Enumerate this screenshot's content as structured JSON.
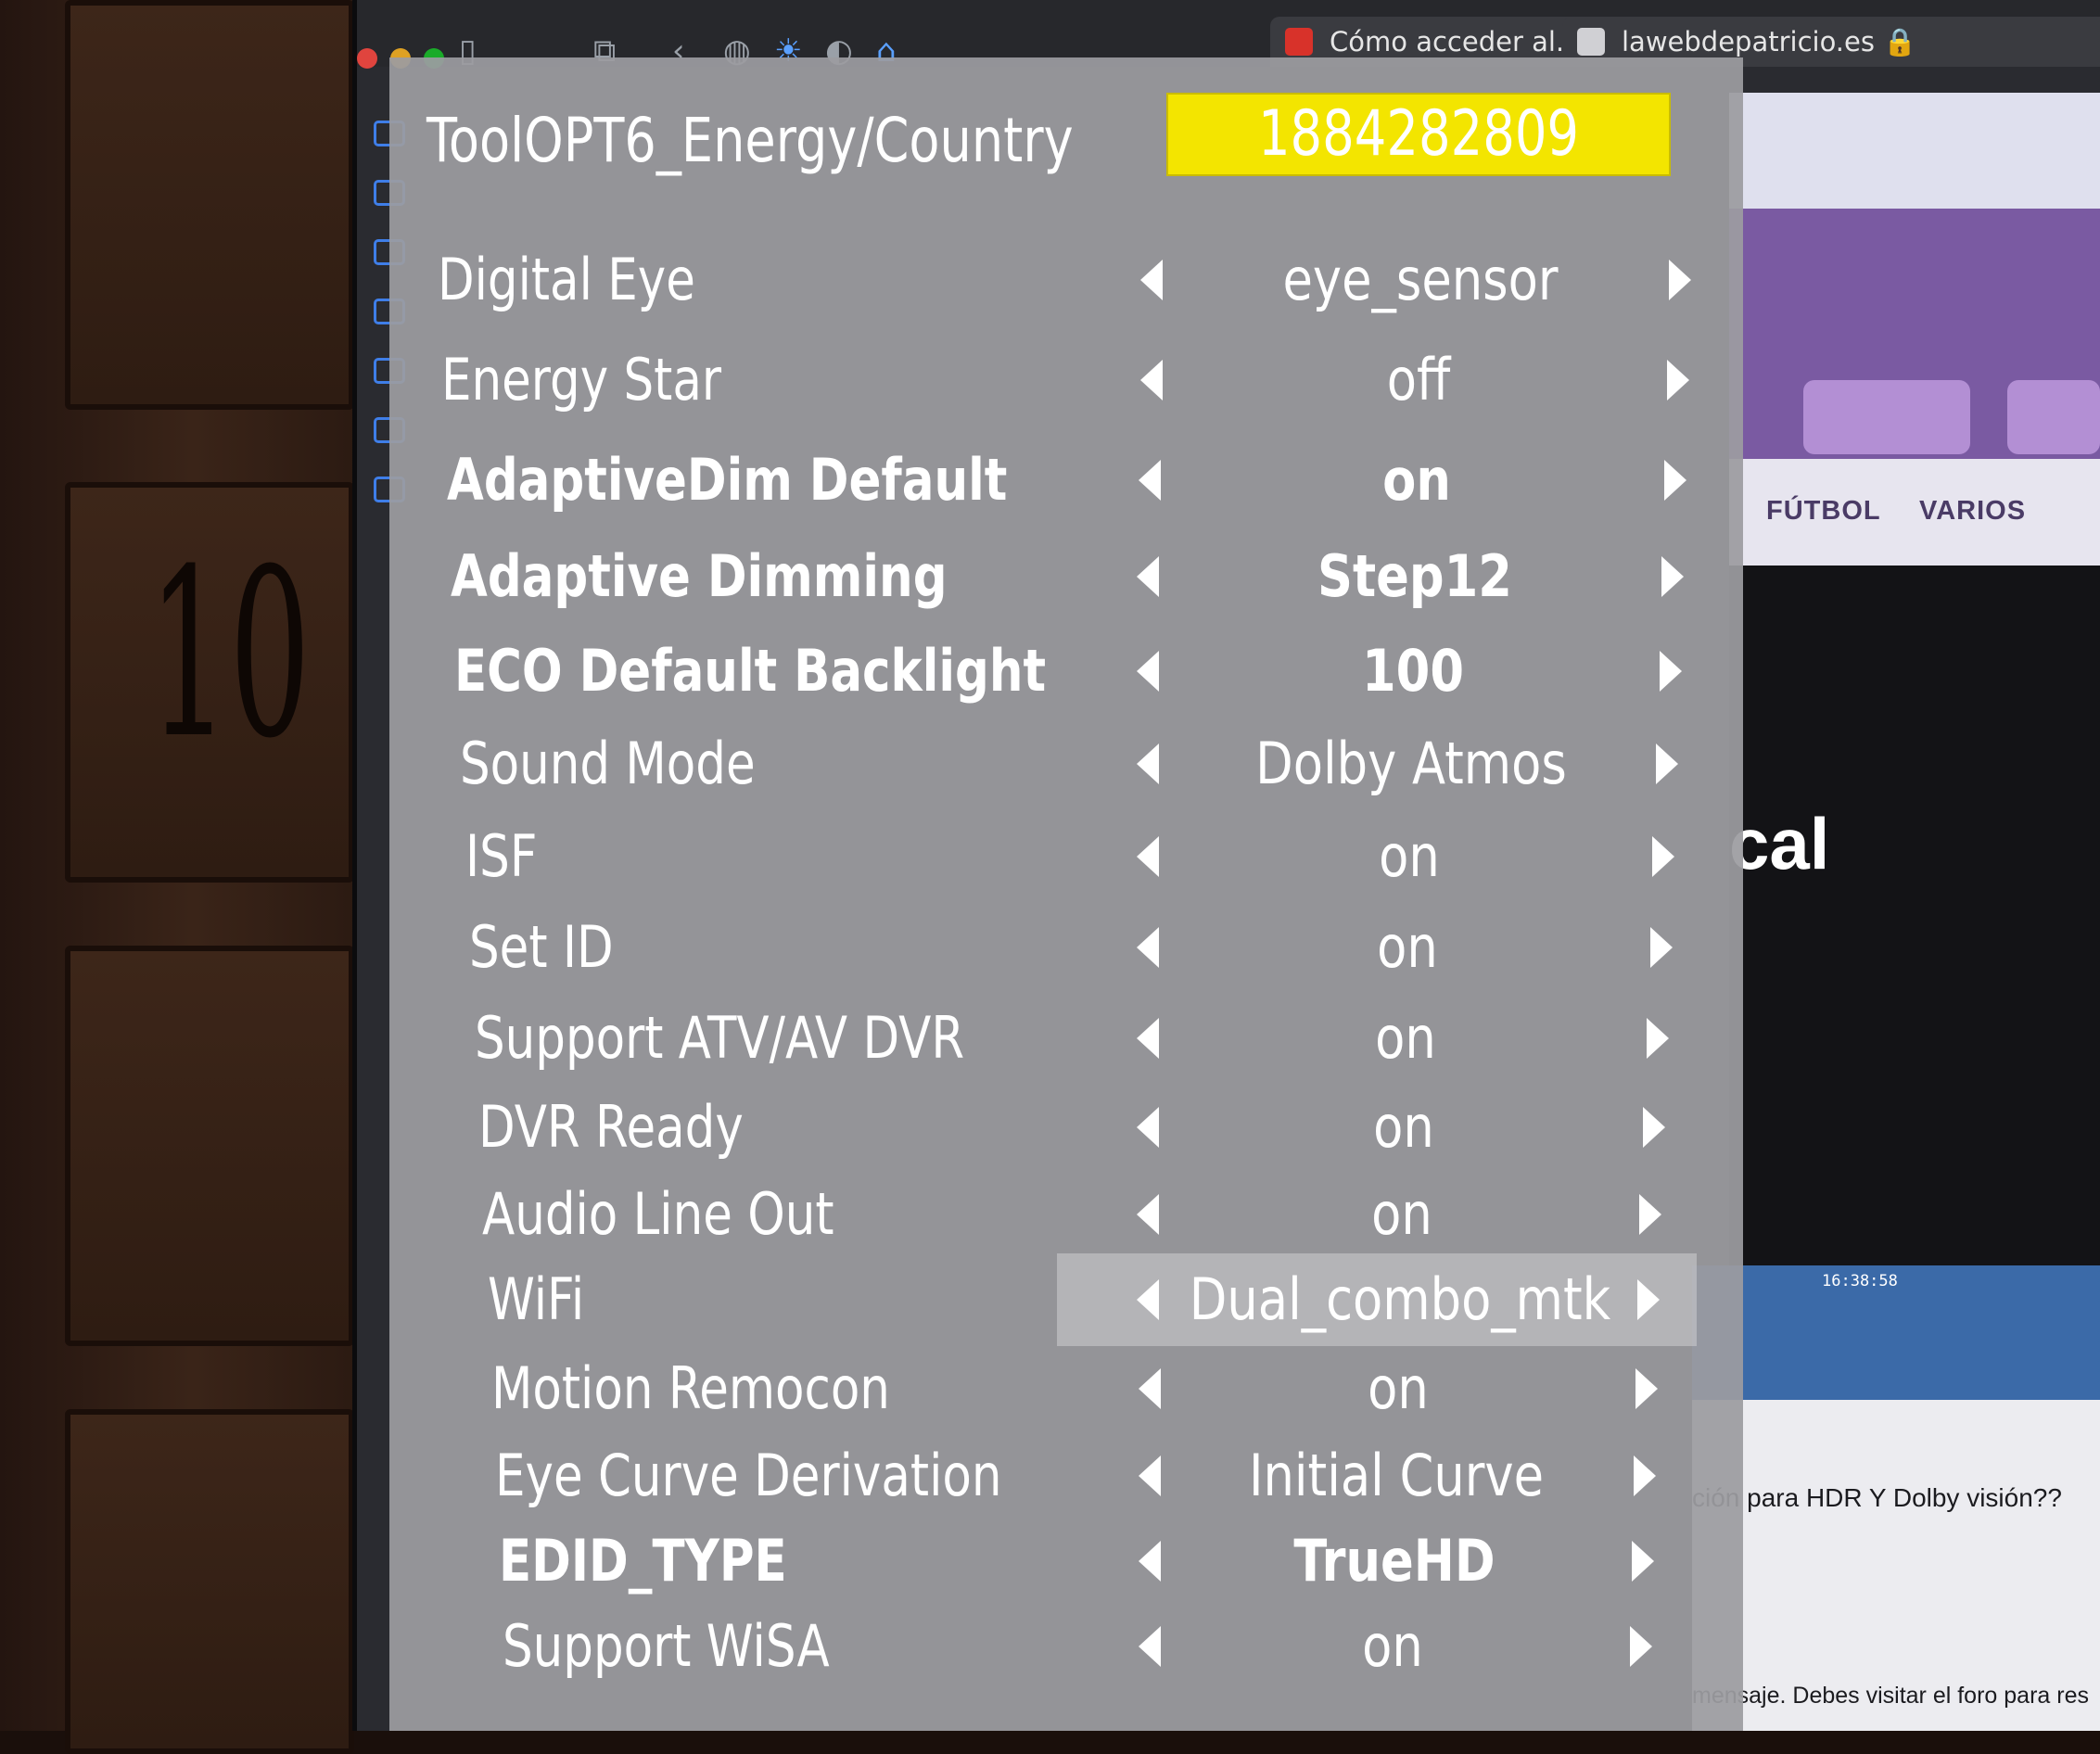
{
  "browser": {
    "tabs": [
      {
        "label": "Cómo acceder al...",
        "favicon_color": "#d8322a"
      },
      {
        "label": "lawebdepatricio.es",
        "favicon_color": "#d0d0d4"
      }
    ]
  },
  "background_site": {
    "nav_items": [
      "FÚTBOL",
      "VARIOS"
    ],
    "heading_fragment": "cal",
    "clock": "16:38:58",
    "fragment_1": "ción para HDR Y Dolby visión??",
    "fragment_2": "mensaje. Debes visitar el foro para res"
  },
  "menu": {
    "title": "ToolOPT6_Energy/Country",
    "code": "1884282809",
    "rows": [
      {
        "label": "Digital Eye",
        "value": "eye_sensor"
      },
      {
        "label": "Energy Star",
        "value": "off"
      },
      {
        "label": "AdaptiveDim Default",
        "value": "on"
      },
      {
        "label": "Adaptive Dimming",
        "value": "Step12"
      },
      {
        "label": "ECO Default Backlight",
        "value": "100"
      },
      {
        "label": "Sound Mode",
        "value": "Dolby Atmos"
      },
      {
        "label": "ISF",
        "value": "on"
      },
      {
        "label": "Set ID",
        "value": "on"
      },
      {
        "label": "Support ATV/AV DVR",
        "value": "on"
      },
      {
        "label": "DVR Ready",
        "value": "on"
      },
      {
        "label": "Audio Line Out",
        "value": "on"
      },
      {
        "label": "WiFi",
        "value": "Dual_combo_mtk"
      },
      {
        "label": "Motion Remocon",
        "value": "on"
      },
      {
        "label": "Eye Curve Derivation",
        "value": "Initial Curve"
      },
      {
        "label": "EDID_TYPE",
        "value": "TrueHD"
      },
      {
        "label": "Support WiSA",
        "value": "on"
      }
    ]
  },
  "colors": {
    "menu_background": "#9c9ca0",
    "code_highlight": "#f3e500",
    "text": "#ffffff"
  }
}
